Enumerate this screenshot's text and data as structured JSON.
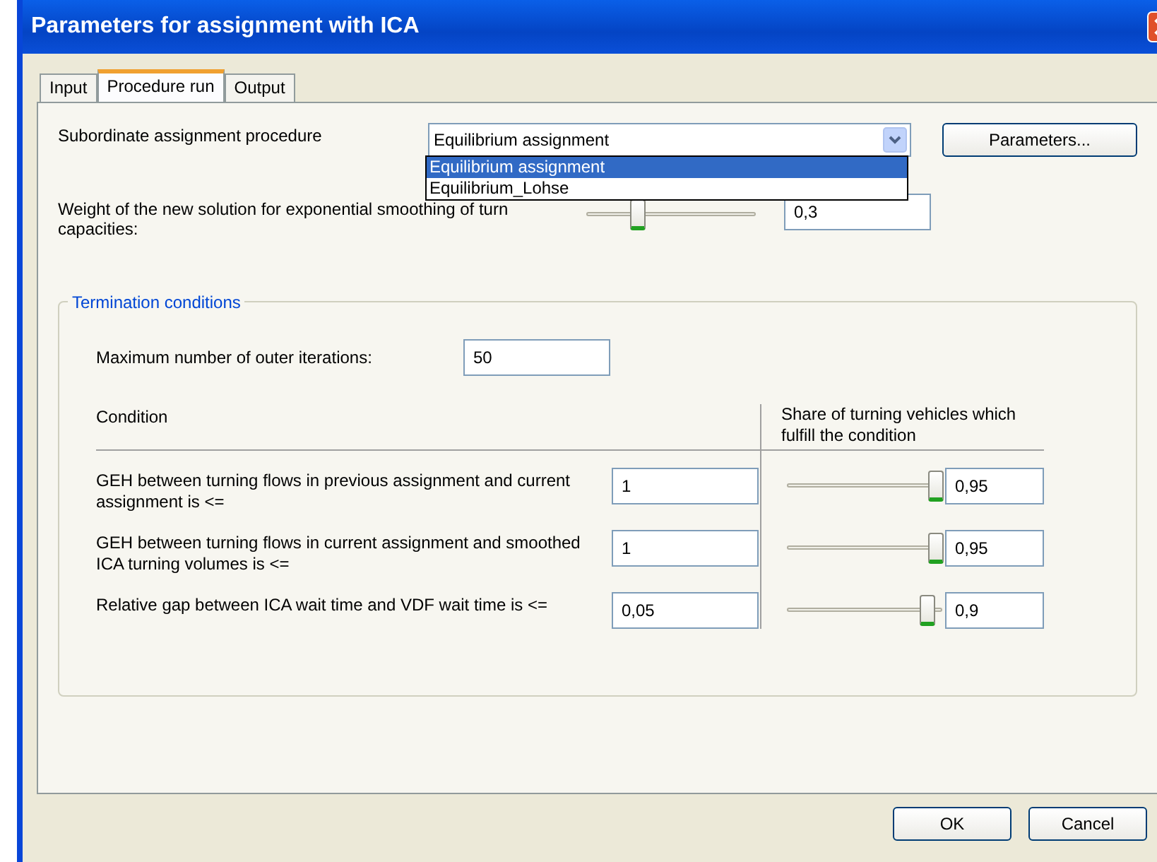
{
  "window": {
    "title": "Parameters for assignment with ICA"
  },
  "tabs": [
    {
      "label": "Input",
      "selected": false
    },
    {
      "label": "Procedure run",
      "selected": true
    },
    {
      "label": "Output",
      "selected": false
    }
  ],
  "procedure": {
    "label": "Subordinate assignment procedure",
    "value": "Equilibrium assignment",
    "options": [
      {
        "label": "Equilibrium assignment",
        "selected": true
      },
      {
        "label": "Equilibrium_Lohse",
        "selected": false
      }
    ]
  },
  "parameters_button": "Parameters...",
  "weight": {
    "label": "Weight of the new solution for exponential smoothing of turn capacities:",
    "level": 0.3,
    "value": "0,3"
  },
  "termination": {
    "title": "Termination conditions",
    "max_iterations": {
      "label": "Maximum number of outer iterations:",
      "value": "50"
    },
    "columns": [
      "Condition",
      "Share of turning vehicles which fulfill the condition"
    ],
    "rows": [
      {
        "label": "GEH between turning flows in previous assignment and current assignment is <=",
        "value": "1",
        "level": 0.95,
        "share": "0,95"
      },
      {
        "label": "GEH between turning flows in current assignment and smoothed ICA turning volumes is <=",
        "value": "1",
        "level": 0.95,
        "share": "0,95"
      },
      {
        "label": "Relative gap between ICA wait time and VDF wait time is <=",
        "value": "0,05",
        "level": 0.9,
        "share": "0,9"
      }
    ]
  },
  "buttons": [
    "OK",
    "Cancel"
  ]
}
